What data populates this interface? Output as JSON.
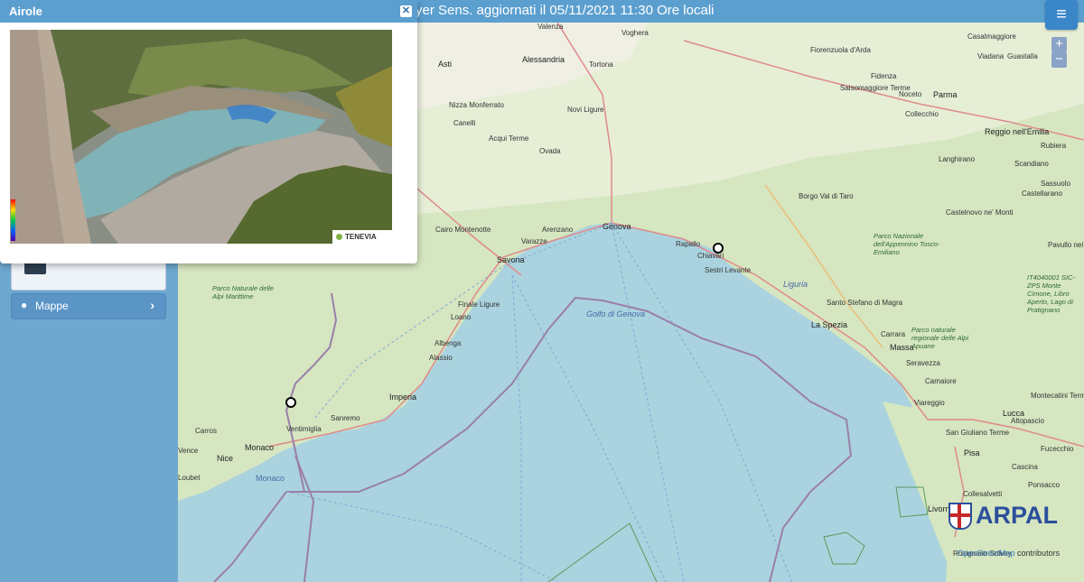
{
  "header": {
    "title": "yer Sens. aggiornati il 05/11/2021 11:30 Ore locali",
    "menu_icon": "hamburger-icon"
  },
  "popup": {
    "title": "Airole",
    "close_icon": "close-icon",
    "watermark": "TENEVIA"
  },
  "sidebar": {
    "mappe_label": "Mappe",
    "mappe_icon": "globe-icon",
    "chevron_icon": "chevron-right-icon"
  },
  "map": {
    "zoom_in": "+",
    "zoom_out": "−",
    "attribution_osm": "OpenStreetMap",
    "attribution_rest": " contributors",
    "brand": "ARPAL",
    "labels": {
      "valenza": "Valenza",
      "voghera": "Voghera",
      "alessandria": "Alessandria",
      "asti": "Asti",
      "tortona": "Tortona",
      "nizza": "Nizza Monferrato",
      "canelli": "Canelli",
      "acqui": "Acqui Terme",
      "novi": "Novi Ligure",
      "ovada": "Ovada",
      "cairo": "Cairo Montenotte",
      "varazze": "Varazze",
      "arenzano": "Arenzano",
      "genova": "Genova",
      "savona": "Savona",
      "finale": "Finale Ligure",
      "loano": "Loano",
      "albenga": "Albenga",
      "alassio": "Alassio",
      "imperia": "Imperia",
      "sanremo": "Sanremo",
      "ventimiglia": "Ventimiglia",
      "monaco": "Monaco",
      "monaco_sea": "Monaco",
      "nice": "Nice",
      "carros": "Carros",
      "vence": "Vence",
      "loubet": "Loubet",
      "rapallo": "Rapallo",
      "chiavari": "Chiavari",
      "sestri": "Sestri Levante",
      "golfo": "Golfo di Genova",
      "liguria": "Liguria",
      "laspezia": "La Spezia",
      "carrara": "Carrara",
      "massa": "Massa",
      "viareggio": "Viareggio",
      "lucca": "Lucca",
      "pisa": "Pisa",
      "livorno": "Livorno",
      "piacenza_area": "Fiorenzuola d'Arda",
      "fidenza": "Fidenza",
      "parma": "Parma",
      "reggio": "Reggio nell'Emilia",
      "borgo": "Borgo Val di Taro",
      "castelnovo": "Castelnovo ne' Monti",
      "salsomaggiore": "Salsomaggiore Terme",
      "noceto": "Noceto",
      "collecchio": "Collecchio",
      "langhirano": "Langhirano",
      "casalmaggiore": "Casalmaggiore",
      "guastalla": "Guastalla",
      "viadana": "Viadana",
      "rubiera": "Rubiera",
      "scandiano": "Scandiano",
      "sassuolo": "Sassuolo",
      "castellarano": "Castellarano",
      "pavullo": "Pavullo nel Frignano",
      "santostefano": "Santo Stefano di Magra",
      "seravezza": "Seravezza",
      "camaiore": "Camaiore",
      "montecatini": "Montecatini Terme",
      "altopascio": "Altopascio",
      "fucecchio": "Fucecchio",
      "cascina": "Cascina",
      "pontedera": "Pontedera",
      "collesalvetti": "Collesalvetti",
      "rosignano": "Rosignano Solvay",
      "sangiuliano": "San Giuliano Terme",
      "pontassieve_area": "Ponsacco",
      "park_alpi_marittime": "Parco Naturale delle Alpi Marittime",
      "park_appennino": "Parco Nazionale dell'Appennino Tosco-Emiliano",
      "park_apuane": "Parco naturale regionale delle Alpi Apuane",
      "park_lago": "IT4040001 SIC-ZPS Monte Cimone, Libro Aperto, Lago di Pratignano"
    }
  }
}
